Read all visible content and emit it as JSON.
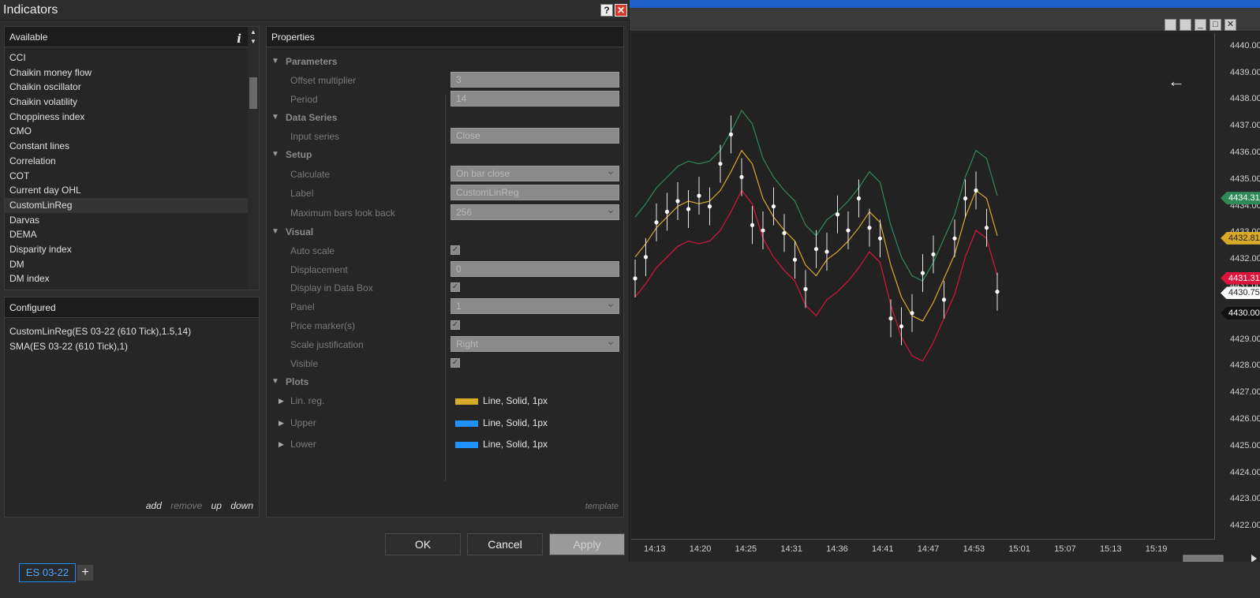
{
  "dialog": {
    "title": "Indicators",
    "help_glyph": "?",
    "close_glyph": "✕",
    "available": {
      "header": "Available",
      "info_glyph": "i",
      "items": [
        "CCI",
        "Chaikin money flow",
        "Chaikin oscillator",
        "Chaikin volatility",
        "Choppiness index",
        "CMO",
        "Constant lines",
        "Correlation",
        "COT",
        "Current day OHL",
        "CustomLinReg",
        "Darvas",
        "DEMA",
        "Disparity index",
        "DM",
        "DM index"
      ],
      "selected_index": 10
    },
    "configured": {
      "header": "Configured",
      "items": [
        "CustomLinReg(ES 03-22 (610 Tick),1.5,14)",
        "SMA(ES 03-22 (610 Tick),1)"
      ],
      "actions": {
        "add": "add",
        "remove": "remove",
        "up": "up",
        "down": "down"
      }
    },
    "properties": {
      "header": "Properties",
      "categories": {
        "parameters": "Parameters",
        "data_series": "Data Series",
        "setup": "Setup",
        "visual": "Visual",
        "plots": "Plots"
      },
      "fields": {
        "offset_multiplier": {
          "label": "Offset multiplier",
          "value": "3"
        },
        "period": {
          "label": "Period",
          "value": "14"
        },
        "input_series": {
          "label": "Input series",
          "value": "Close"
        },
        "calculate": {
          "label": "Calculate",
          "value": "On bar close"
        },
        "label": {
          "label": "Label",
          "value": "CustomLinReg"
        },
        "max_bars": {
          "label": "Maximum bars look back",
          "value": "256"
        },
        "auto_scale": {
          "label": "Auto scale",
          "checked": true
        },
        "displacement": {
          "label": "Displacement",
          "value": "0"
        },
        "display_data_box": {
          "label": "Display in Data Box",
          "checked": true
        },
        "panel": {
          "label": "Panel",
          "value": "1"
        },
        "price_markers": {
          "label": "Price marker(s)",
          "checked": true
        },
        "scale_justification": {
          "label": "Scale justification",
          "value": "Right"
        },
        "visible": {
          "label": "Visible",
          "checked": true
        }
      },
      "plots": [
        {
          "name": "Lin. reg.",
          "style": "Line, Solid, 1px",
          "color": "#d9a928"
        },
        {
          "name": "Upper",
          "style": "Line, Solid, 1px",
          "color": "#1e90ff"
        },
        {
          "name": "Lower",
          "style": "Line, Solid, 1px",
          "color": "#1e90ff"
        }
      ],
      "template_link": "template"
    },
    "buttons": {
      "ok": "OK",
      "cancel": "Cancel",
      "apply": "Apply"
    }
  },
  "chart": {
    "back_glyph": "←",
    "price_labels": [
      "4440.00",
      "4439.00",
      "4438.00",
      "4437.00",
      "4436.00",
      "4435.00",
      "4434.00",
      "4433.00",
      "4432.00",
      "4431.00",
      "4430.00",
      "4429.00",
      "4428.00",
      "4427.00",
      "4426.00",
      "4425.00",
      "4424.00",
      "4423.00",
      "4422.00"
    ],
    "price_markers": [
      {
        "value": "4434.31",
        "bg": "#2e8b57",
        "fg": "#ffffff"
      },
      {
        "value": "4432.81",
        "bg": "#d9a928",
        "fg": "#222222"
      },
      {
        "value": "4431.31",
        "bg": "#dc143c",
        "fg": "#ffffff"
      },
      {
        "value": "4430.75",
        "bg": "#ffffff",
        "fg": "#222222"
      },
      {
        "value": "4430.00",
        "bg": "#111111",
        "fg": "#ffffff"
      }
    ],
    "time_labels": [
      "14:13",
      "14:20",
      "14:25",
      "14:31",
      "14:36",
      "14:41",
      "14:47",
      "14:53",
      "15:01",
      "15:07",
      "15:13",
      "15:19"
    ],
    "colors": {
      "linreg": "#d9a928",
      "upper": "#2e8b57",
      "lower": "#dc143c",
      "price": "#ffffff"
    }
  },
  "chart_data": {
    "type": "line",
    "ylim": [
      4421.5,
      4440.5
    ],
    "series": [
      {
        "name": "Lin. reg.",
        "values": [
          4432.1,
          4432.6,
          4433.2,
          4433.6,
          4434.0,
          4434.2,
          4434.1,
          4434.2,
          4434.6,
          4435.3,
          4436.1,
          4435.6,
          4434.3,
          4433.6,
          4433.1,
          4432.7,
          4431.8,
          4431.4,
          4432.0,
          4432.3,
          4432.7,
          4433.2,
          4433.8,
          4433.4,
          4431.8,
          4430.6,
          4429.9,
          4429.7,
          4430.4,
          4431.3,
          4432.2,
          4433.6,
          4434.6,
          4434.3,
          4432.9
        ]
      },
      {
        "name": "Upper",
        "values": [
          4433.6,
          4434.1,
          4434.7,
          4435.1,
          4435.5,
          4435.7,
          4435.6,
          4435.7,
          4436.1,
          4436.8,
          4437.6,
          4437.1,
          4435.8,
          4435.1,
          4434.6,
          4434.2,
          4433.3,
          4432.9,
          4433.5,
          4433.8,
          4434.2,
          4434.7,
          4435.3,
          4434.9,
          4433.3,
          4432.1,
          4431.4,
          4431.2,
          4431.9,
          4432.8,
          4433.7,
          4435.1,
          4436.1,
          4435.8,
          4434.4
        ]
      },
      {
        "name": "Lower",
        "values": [
          4430.6,
          4431.1,
          4431.7,
          4432.1,
          4432.5,
          4432.7,
          4432.6,
          4432.7,
          4433.1,
          4433.8,
          4434.6,
          4434.1,
          4432.8,
          4432.1,
          4431.6,
          4431.2,
          4430.3,
          4429.9,
          4430.5,
          4430.8,
          4431.2,
          4431.7,
          4432.3,
          4431.9,
          4430.3,
          4429.1,
          4428.4,
          4428.2,
          4428.9,
          4429.8,
          4430.7,
          4432.1,
          4433.1,
          4432.8,
          4431.4
        ]
      },
      {
        "name": "Price",
        "values": [
          4431.3,
          4432.1,
          4433.4,
          4433.8,
          4434.2,
          4433.9,
          4434.4,
          4434.0,
          4435.6,
          4436.7,
          4435.1,
          4433.3,
          4433.1,
          4434.0,
          4433.0,
          4432.0,
          4430.9,
          4432.4,
          4432.3,
          4433.7,
          4433.1,
          4434.3,
          4433.2,
          4432.8,
          4429.8,
          4429.5,
          4430.0,
          4431.5,
          4432.2,
          4430.5,
          4432.8,
          4434.3,
          4434.6,
          4433.2,
          4430.8
        ]
      }
    ]
  }
}
